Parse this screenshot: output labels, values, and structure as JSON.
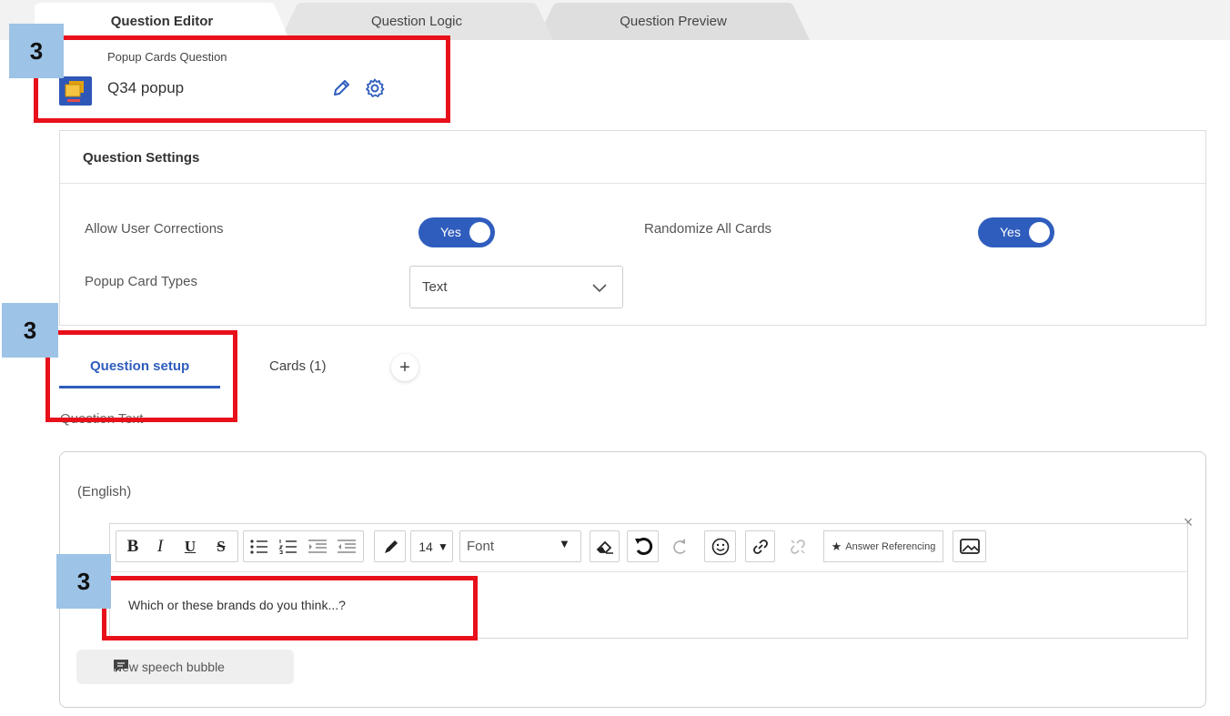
{
  "tabs": [
    {
      "label": "Question Editor",
      "active": true
    },
    {
      "label": "Question Logic",
      "active": false
    },
    {
      "label": "Question Preview",
      "active": false
    }
  ],
  "question": {
    "type_label": "Popup Cards Question",
    "name": "Q34 popup",
    "icon": "popup-cards-icon"
  },
  "settings": {
    "title": "Question Settings",
    "allow_corrections": {
      "label": "Allow User Corrections",
      "toggle": "Yes"
    },
    "randomize_cards": {
      "label": "Randomize All Cards",
      "toggle": "Yes"
    },
    "card_types": {
      "label": "Popup Card Types",
      "value": "Text"
    }
  },
  "subtabs": {
    "setup": "Question setup",
    "cards": "Cards (1)",
    "add": "+"
  },
  "question_text": {
    "label": "Question Text",
    "language": "(English)",
    "close": "×",
    "toolbar": {
      "bold": "B",
      "italic": "I",
      "underline": "U",
      "strike": "S",
      "font_size": "14",
      "font_size_caret": "▼",
      "font": "Font",
      "font_caret": "▼",
      "answer_referencing_star": "★",
      "answer_referencing": "Answer Referencing"
    },
    "content": "Which or these brands do you think...?",
    "speech_bubble_button": "New speech bubble"
  },
  "annotations": {
    "badge_1": "3",
    "badge_2": "3",
    "badge_3": "3"
  },
  "colors": {
    "accent": "#2f5dbd",
    "annotation_red": "#e8101a",
    "annotation_badge": "#9dc3e6"
  }
}
